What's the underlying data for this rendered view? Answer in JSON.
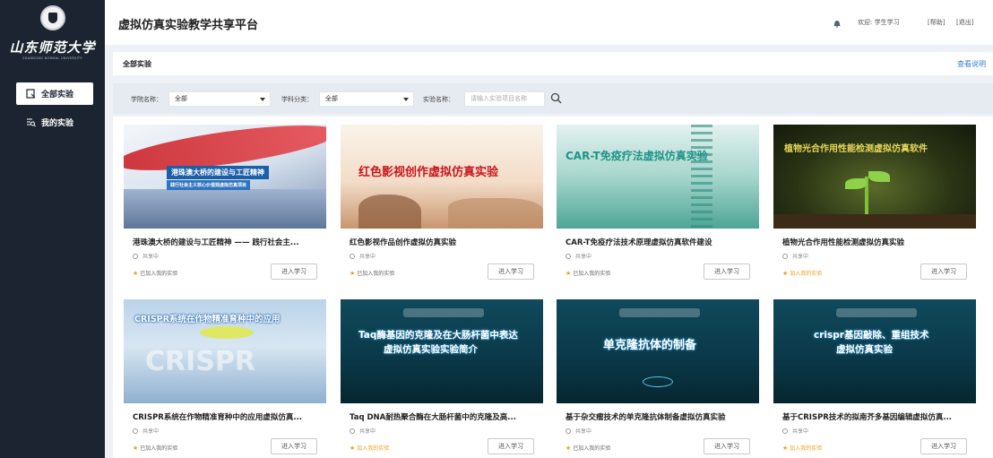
{
  "sidebar": {
    "logo_name": "山东师范大学",
    "logo_sub": "SHANDONG NORMAL UNIVERSITY",
    "nav": [
      {
        "label": "全部实验",
        "active": true,
        "icon": "file-icon"
      },
      {
        "label": "我的实验",
        "active": false,
        "icon": "search-doc-icon"
      }
    ]
  },
  "header": {
    "title": "虚拟仿真实验教学共享平台",
    "welcome": "欢迎: 学生学习",
    "help": "[帮助]",
    "logout": "[退出]"
  },
  "section": {
    "title": "全部实验",
    "help_link": "查看说明"
  },
  "filters": {
    "college_label": "学院名称：",
    "college_value": "全部",
    "subject_label": "学科分类：",
    "subject_value": "全部",
    "name_label": "实验名称：",
    "name_placeholder": "请输入实验项目名称"
  },
  "colors": {
    "sidebar_bg": "#1b2430",
    "accent_blue": "#3a7bd5",
    "star_orange": "#f0a020"
  },
  "cards": [
    {
      "title": "港珠澳大桥的建设与工匠精神 —— 践行社会主...",
      "status": "共享中",
      "joined": "已加入我的实验",
      "enter": "进入学习",
      "img_lines": [
        "港珠澳大桥的建设与工匠精神",
        "践行社会主义核心价值观虚拟仿真项目"
      ]
    },
    {
      "title": "红色影视作品创作虚拟仿真实验",
      "status": "共享中",
      "joined": "已加入我的实验",
      "enter": "进入学习",
      "img_lines": [
        "红色影视创作虚拟仿真实验"
      ]
    },
    {
      "title": "CAR-T免疫疗法技术原理虚拟仿真软件建设",
      "status": "共享中",
      "joined": "已加入我的实验",
      "enter": "进入学习",
      "img_lines": [
        "CAR-T免疫疗法虚拟仿真实验"
      ]
    },
    {
      "title": "植物光合作用性能检测虚拟仿真实验",
      "status": "共享中",
      "joined": "加入我的实验",
      "enter": "进入学习",
      "img_lines": [
        "植物光合作用性能检测虚拟仿真软件"
      ]
    },
    {
      "title": "CRISPR系统在作物精准育种中的应用虚拟仿真...",
      "status": "共享中",
      "joined": "已加入我的实验",
      "enter": "进入学习",
      "img_lines": [
        "CRISPR系统在作物精准育种中的应用",
        "CRISPR"
      ]
    },
    {
      "title": "Taq DNA耐热聚合酶在大肠杆菌中的克隆及高...",
      "status": "共享中",
      "joined": "加入我的实验",
      "enter": "进入学习",
      "img_lines": [
        "Taq酶基因的克隆及在大肠杆菌中表达",
        "虚拟仿真实验实验简介"
      ]
    },
    {
      "title": "基于杂交瘤技术的单克隆抗体制备虚拟仿真实验",
      "status": "共享中",
      "joined": "已加入我的实验",
      "enter": "进入学习",
      "img_lines": [
        "单克隆抗体的制备"
      ]
    },
    {
      "title": "基于CRISPR技术的拟南芥多基因编辑虚拟仿真...",
      "status": "共享中",
      "joined": "加入我的实验",
      "enter": "进入学习",
      "img_lines": [
        "crispr基因敲除、重组技术",
        "虚拟仿真实验"
      ]
    }
  ]
}
